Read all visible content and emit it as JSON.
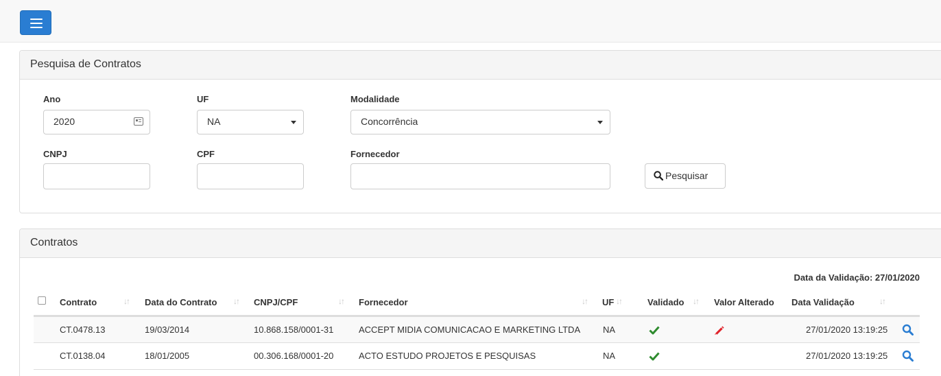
{
  "search_panel": {
    "title": "Pesquisa de Contratos",
    "ano_label": "Ano",
    "ano_value": "2020",
    "uf_label": "UF",
    "uf_value": "NA",
    "modalidade_label": "Modalidade",
    "modalidade_value": "Concorrência",
    "cnpj_label": "CNPJ",
    "cnpj_value": "",
    "cpf_label": "CPF",
    "cpf_value": "",
    "fornecedor_label": "Fornecedor",
    "fornecedor_value": "",
    "search_button": "Pesquisar"
  },
  "contracts_panel": {
    "title": "Contratos",
    "validation_date": "Data da Validação: 27/01/2020",
    "columns": {
      "contrato": "Contrato",
      "data_contrato": "Data do Contrato",
      "cnpj_cpf": "CNPJ/CPF",
      "fornecedor": "Fornecedor",
      "uf": "UF",
      "validado": "Validado",
      "valor_alterado": "Valor Alterado",
      "data_validacao": "Data Validação"
    },
    "rows": [
      {
        "contrato": "CT.0478.13",
        "data_contrato": "19/03/2014",
        "cnpj_cpf": "10.868.158/0001-31",
        "fornecedor": "ACCEPT MIDIA COMUNICACAO E MARKETING LTDA",
        "uf": "NA",
        "validado_icon": "check-icon",
        "valor_alterado_icon": "pencil-icon",
        "data_validacao": "27/01/2020 13:19:25"
      },
      {
        "contrato": "CT.0138.04",
        "data_contrato": "18/01/2005",
        "cnpj_cpf": "00.306.168/0001-20",
        "fornecedor": "ACTO ESTUDO PROJETOS E PESQUISAS",
        "uf": "NA",
        "validado_icon": "check-icon",
        "valor_alterado_icon": "",
        "data_validacao": "27/01/2020 13:19:25"
      }
    ]
  },
  "colors": {
    "primary": "#2a7dd2",
    "check": "#2e8b2e",
    "pencil": "#e0232a",
    "search_icon": "#2a7dd2"
  }
}
